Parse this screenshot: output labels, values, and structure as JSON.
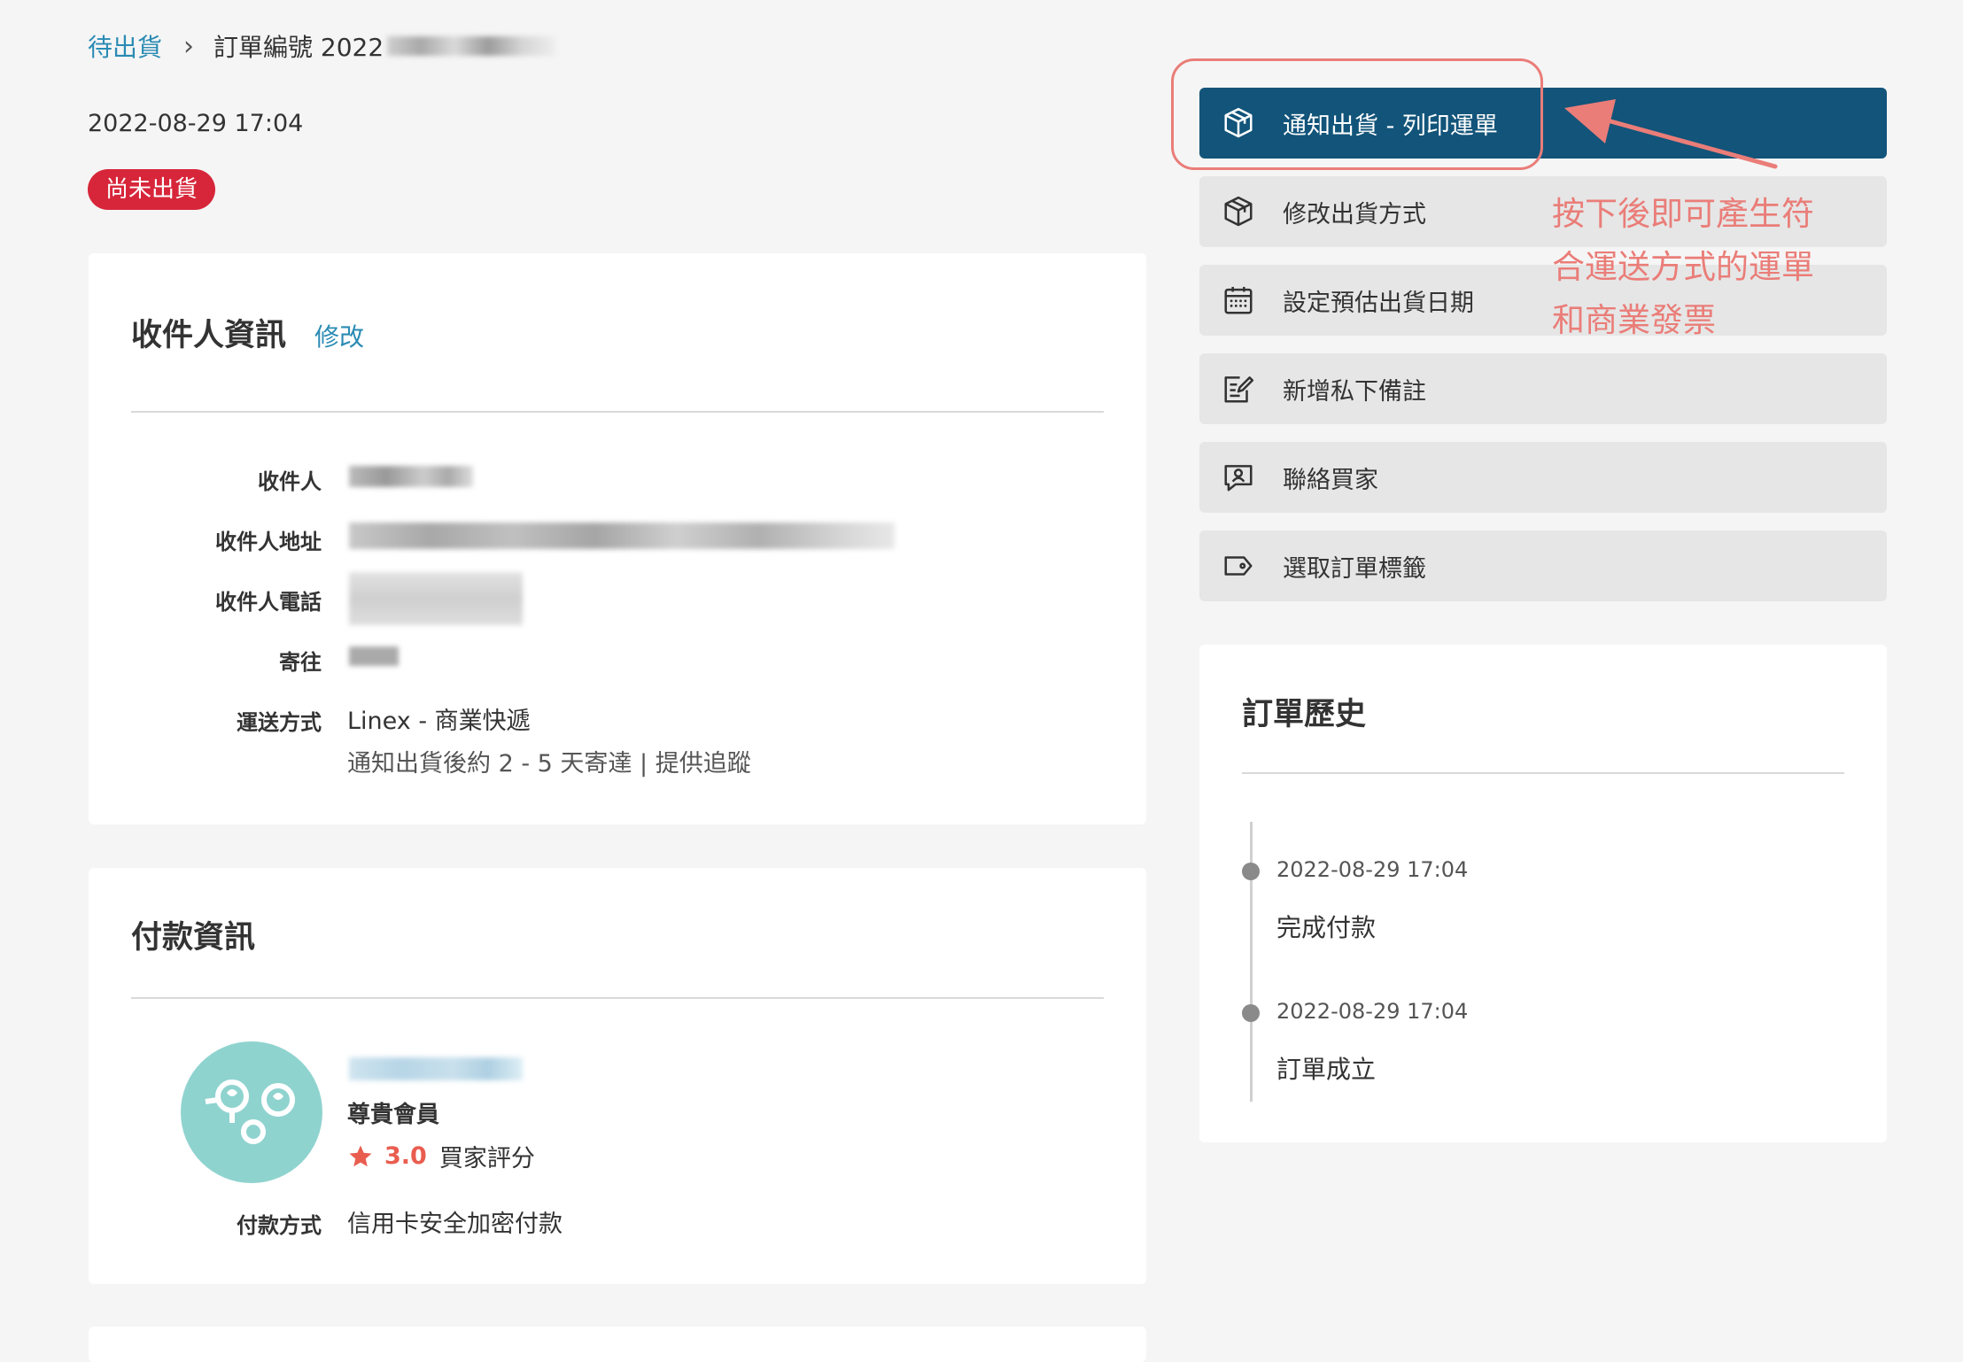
{
  "breadcrumb": {
    "parent": "待出貨",
    "separator": "›",
    "order_label": "訂單編號 2022"
  },
  "order_date": "2022-08-29 17:04",
  "status_badge": "尚未出貨",
  "recipient_card": {
    "title": "收件人資訊",
    "edit_link": "修改",
    "fields": {
      "recipient_label": "收件人",
      "address_label": "收件人地址",
      "phone_label": "收件人電話",
      "ship_to_label": "寄往",
      "shipping_method_label": "運送方式",
      "shipping_method_value": "Linex - 商業快遞",
      "shipping_method_detail": "通知出貨後約 2 - 5 天寄達 | 提供追蹤"
    }
  },
  "payment_card": {
    "title": "付款資訊",
    "member_tier": "尊貴會員",
    "rating": "3.0",
    "rating_label": "買家評分",
    "payment_method_label": "付款方式",
    "payment_method_value": "信用卡安全加密付款"
  },
  "actions": [
    {
      "label": "通知出貨 - 列印運單",
      "icon": "package-icon"
    },
    {
      "label": "修改出貨方式",
      "icon": "package-icon"
    },
    {
      "label": "設定預估出貨日期",
      "icon": "calendar-icon"
    },
    {
      "label": "新增私下備註",
      "icon": "note-edit-icon"
    },
    {
      "label": "聯絡買家",
      "icon": "chat-user-icon"
    },
    {
      "label": "選取訂單標籤",
      "icon": "tag-icon"
    }
  ],
  "annotation": {
    "lines": [
      "按下後即可產生符",
      "合運送方式的運單",
      "和商業發票"
    ]
  },
  "history": {
    "title": "訂單歷史",
    "events": [
      {
        "date": "2022-08-29 17:04",
        "event": "完成付款"
      },
      {
        "date": "2022-08-29 17:04",
        "event": "訂單成立"
      }
    ]
  },
  "colors": {
    "primary": "#12547a",
    "link": "#2a8bb4",
    "badge": "#d7263a",
    "annotation": "#ea7d78",
    "avatar": "#8fd3cf",
    "star": "#e95d4f"
  }
}
